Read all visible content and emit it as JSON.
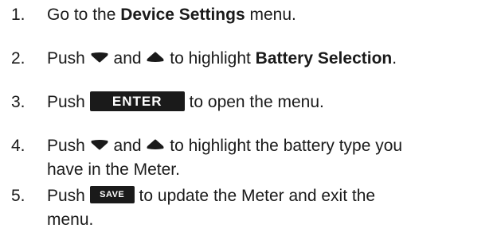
{
  "steps": [
    {
      "number": "1.",
      "pre": "Go to the ",
      "bold": "Device Settings",
      "post": " menu."
    },
    {
      "number": "2.",
      "pre": "Push ",
      "mid1": " and ",
      "mid2": " to highlight ",
      "bold": "Battery Selection",
      "post": "."
    },
    {
      "number": "3.",
      "pre": "Push ",
      "button": "ENTER",
      "post": " to open the menu."
    },
    {
      "number": "4.",
      "pre": "Push ",
      "mid1": " and ",
      "post_line1": " to highlight the battery type you",
      "line2": "have in the Meter."
    },
    {
      "number": "5.",
      "pre": "Push ",
      "button": "SAVE",
      "post_line1": " to update the Meter and exit the",
      "line2": "menu."
    }
  ],
  "icons": {
    "down": "down-arrow-icon",
    "up": "up-arrow-icon"
  },
  "colors": {
    "text": "#1a1a1a",
    "button_bg": "#1a1a1a",
    "button_text": "#ffffff"
  }
}
